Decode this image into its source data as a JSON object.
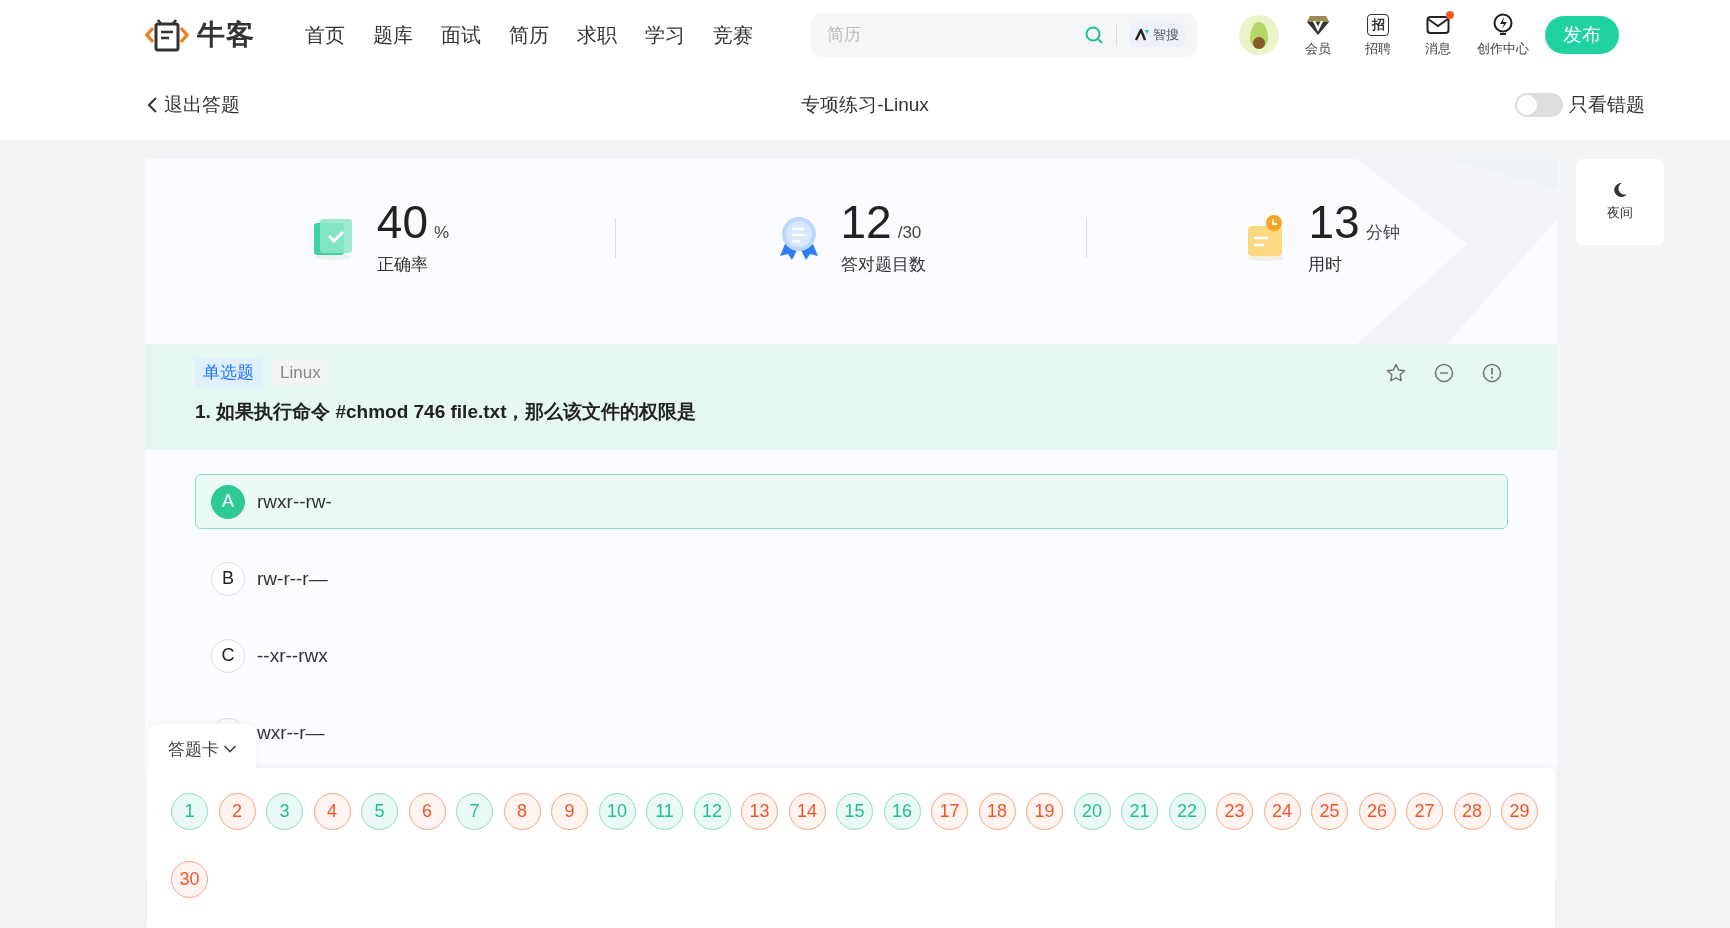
{
  "header": {
    "logo": "牛客",
    "nav": [
      "首页",
      "题库",
      "面试",
      "简历",
      "求职",
      "学习",
      "竞赛"
    ],
    "search": {
      "placeholder": "简历"
    },
    "ai_search": "智搜",
    "user_menu": [
      {
        "kind": "vip",
        "label": "会员",
        "badge": false
      },
      {
        "kind": "recruit",
        "icon_text": "招",
        "label": "招聘",
        "badge": false
      },
      {
        "kind": "message",
        "label": "消息",
        "badge": true
      },
      {
        "kind": "create",
        "label": "创作中心",
        "badge": false
      }
    ],
    "publish": "发布"
  },
  "subheader": {
    "back": "退出答题",
    "title": "专项练习-Linux",
    "only_wrong": {
      "label": "只看错题",
      "on": false
    }
  },
  "night_mode": "夜间",
  "stats": [
    {
      "kind": "accuracy",
      "value": "40",
      "unit": "%",
      "label": "正确率"
    },
    {
      "kind": "count",
      "value": "12",
      "unit": "/30",
      "label": "答对题目数"
    },
    {
      "kind": "time",
      "value": "13",
      "unit": "分钟",
      "label": "用时"
    }
  ],
  "question": {
    "tags": [
      {
        "kind": "type",
        "label": "单选题"
      },
      {
        "kind": "topic",
        "label": "Linux"
      }
    ],
    "text": "1. 如果执行命令 #chmod 746 file.txt，那么该文件的权限是",
    "options": [
      {
        "letter": "A",
        "text": "rwxr--rw-",
        "selected": true
      },
      {
        "letter": "B",
        "text": "rw-r--r—",
        "selected": false
      },
      {
        "letter": "C",
        "text": "--xr--rwx",
        "selected": false
      },
      {
        "text": "wxr--r—",
        "selected": false
      }
    ]
  },
  "answer_card": {
    "title": "答题卡",
    "items": [
      {
        "number": "1",
        "correct": true
      },
      {
        "number": "2",
        "correct": false
      },
      {
        "number": "3",
        "correct": true
      },
      {
        "number": "4",
        "correct": false
      },
      {
        "number": "5",
        "correct": true
      },
      {
        "number": "6",
        "correct": false
      },
      {
        "number": "7",
        "correct": true
      },
      {
        "number": "8",
        "correct": false
      },
      {
        "number": "9",
        "correct": false
      },
      {
        "number": "10",
        "correct": true
      },
      {
        "number": "11",
        "correct": true
      },
      {
        "number": "12",
        "correct": true
      },
      {
        "number": "13",
        "correct": false
      },
      {
        "number": "14",
        "correct": false
      },
      {
        "number": "15",
        "correct": true
      },
      {
        "number": "16",
        "correct": true
      },
      {
        "number": "17",
        "correct": false
      },
      {
        "number": "18",
        "correct": false
      },
      {
        "number": "19",
        "correct": false
      },
      {
        "number": "20",
        "correct": true
      },
      {
        "number": "21",
        "correct": true
      },
      {
        "number": "22",
        "correct": true
      },
      {
        "number": "23",
        "correct": false
      },
      {
        "number": "24",
        "correct": false
      },
      {
        "number": "25",
        "correct": false
      },
      {
        "number": "26",
        "correct": false
      },
      {
        "number": "27",
        "correct": false
      },
      {
        "number": "28",
        "correct": false
      },
      {
        "number": "29",
        "correct": false
      },
      {
        "number": "30",
        "correct": false
      }
    ]
  }
}
